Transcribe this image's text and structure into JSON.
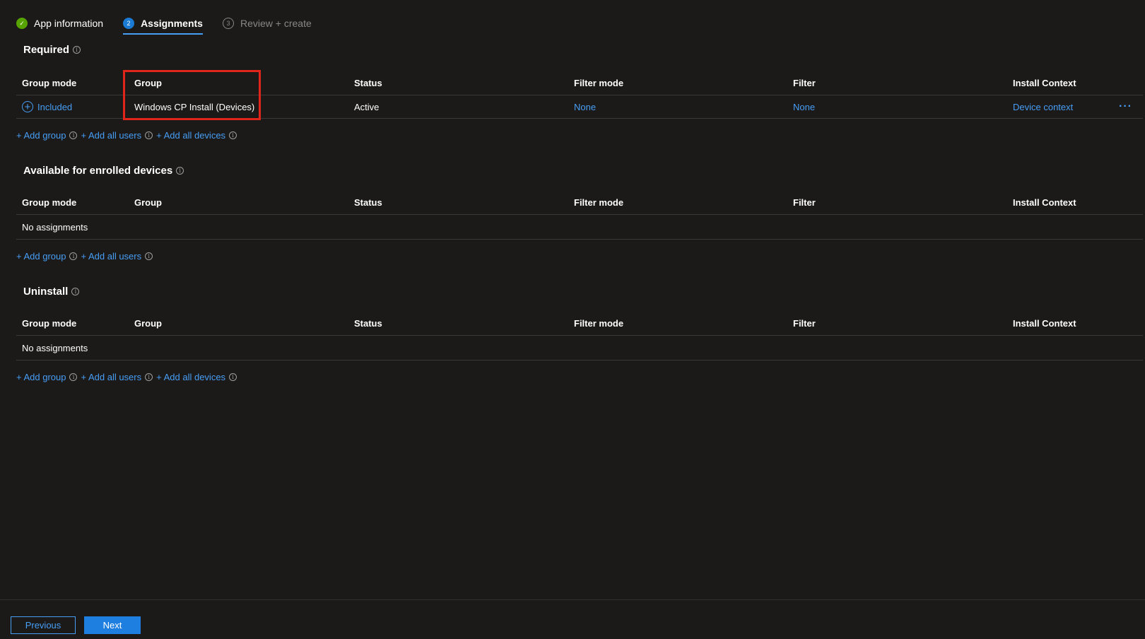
{
  "tabs": [
    {
      "label": "App information",
      "step": "✓",
      "state": "done"
    },
    {
      "label": "Assignments",
      "step": "2",
      "state": "active"
    },
    {
      "label": "Review + create",
      "step": "3",
      "state": "pending"
    }
  ],
  "columns": {
    "group_mode": "Group mode",
    "group": "Group",
    "status": "Status",
    "filter_mode": "Filter mode",
    "filter": "Filter",
    "install_context": "Install Context"
  },
  "required": {
    "title": "Required",
    "row": {
      "group_mode": "Included",
      "group": "Windows CP Install (Devices)",
      "status": "Active",
      "filter_mode": "None",
      "filter": "None",
      "install_context": "Device context",
      "more": "···"
    },
    "links": {
      "add_group": "+ Add group",
      "add_all_users": "+ Add all users",
      "add_all_devices": "+ Add all devices"
    }
  },
  "available": {
    "title": "Available for enrolled devices",
    "empty": "No assignments",
    "links": {
      "add_group": "+ Add group",
      "add_all_users": "+ Add all users"
    }
  },
  "uninstall": {
    "title": "Uninstall",
    "empty": "No assignments",
    "links": {
      "add_group": "+ Add group",
      "add_all_users": "+ Add all users",
      "add_all_devices": "+ Add all devices"
    }
  },
  "footer": {
    "previous": "Previous",
    "next": "Next"
  },
  "colors": {
    "background": "#1b1a19",
    "link": "#479ef5",
    "highlight": "#e0261b",
    "done": "#57a300"
  }
}
